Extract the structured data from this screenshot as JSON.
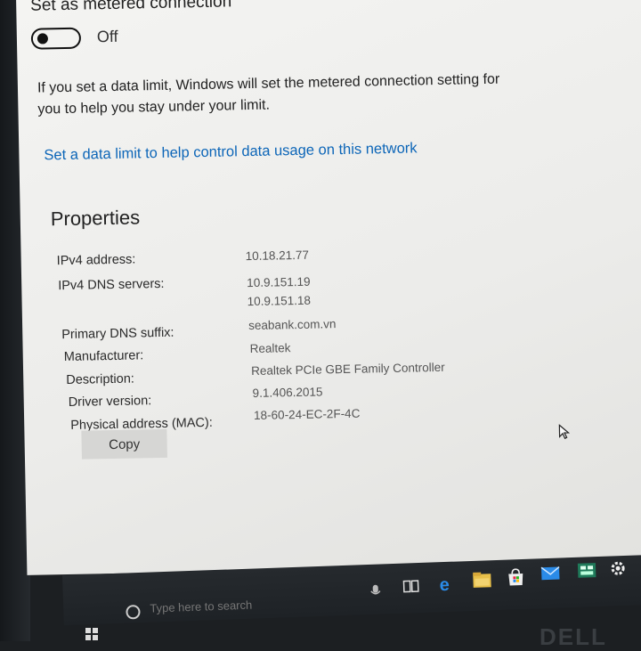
{
  "metered": {
    "label": "Set as metered connection",
    "toggle_state": "Off",
    "info": "If you set a data limit, Windows will set the metered connection setting for you to help you stay under your limit.",
    "link": "Set a data limit to help control data usage on this network"
  },
  "properties": {
    "heading": "Properties",
    "ipv4_label": "IPv4 address:",
    "ipv4_value": "10.18.21.77",
    "dns_label": "IPv4 DNS servers:",
    "dns_value_1": "10.9.151.19",
    "dns_value_2": "10.9.151.18",
    "suffix_label": "Primary DNS suffix:",
    "suffix_value": "seabank.com.vn",
    "manufacturer_label": "Manufacturer:",
    "manufacturer_value": "Realtek",
    "description_label": "Description:",
    "description_value": "Realtek PCIe GBE Family Controller",
    "driver_label": "Driver version:",
    "driver_value": "9.1.406.2015",
    "mac_label": "Physical address (MAC):",
    "mac_value": "18-60-24-EC-2F-4C",
    "copy_label": "Copy"
  },
  "taskbar": {
    "search_placeholder": "Type here to search",
    "icons": [
      "mic-icon",
      "task-view-icon",
      "edge-icon",
      "file-explorer-icon",
      "store-icon",
      "mail-icon",
      "app-icon",
      "settings-icon"
    ]
  },
  "monitor": {
    "brand": "DELL"
  },
  "colors": {
    "link": "#0d66b8",
    "background": "#f0f0ee",
    "taskbar": "#22262a"
  }
}
